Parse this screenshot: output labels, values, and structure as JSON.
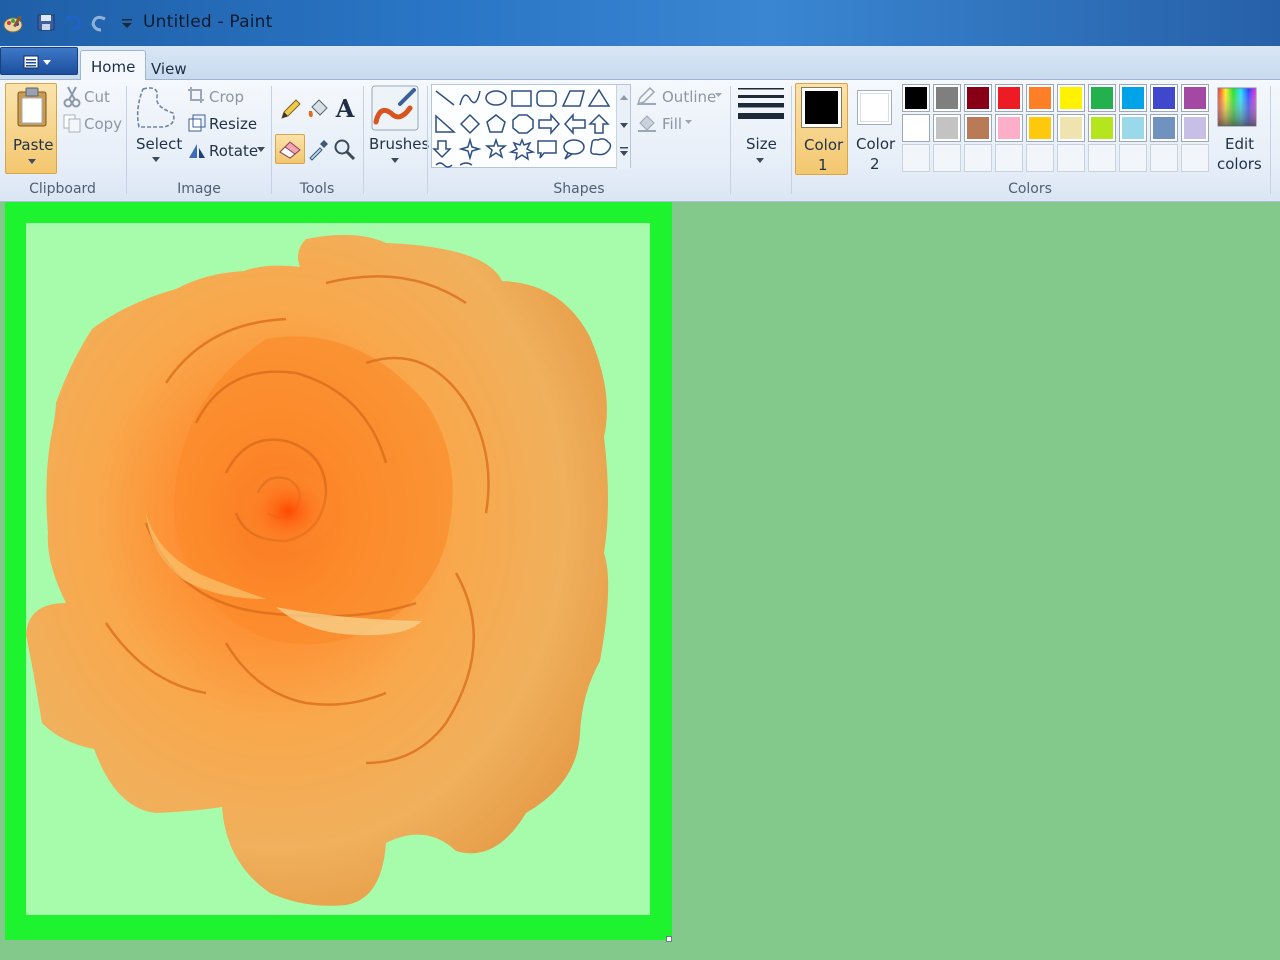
{
  "window": {
    "title": "Untitled - Paint"
  },
  "tabs": [
    {
      "label": "Home"
    },
    {
      "label": "View"
    }
  ],
  "ribbon": {
    "clipboard": {
      "paste_label": "Paste",
      "cut_label": "Cut",
      "copy_label": "Copy",
      "group_label": "Clipboard"
    },
    "image": {
      "select_label": "Select",
      "crop_label": "Crop",
      "resize_label": "Resize",
      "rotate_label": "Rotate",
      "group_label": "Image"
    },
    "tools": {
      "group_label": "Tools",
      "text_tool_glyph": "A"
    },
    "brushes": {
      "label": "Brushes"
    },
    "shapes": {
      "outline_label": "Outline",
      "fill_label": "Fill",
      "group_label": "Shapes"
    },
    "size": {
      "label": "Size"
    },
    "colors": {
      "color1_label": "Color",
      "color1_number": "1",
      "color2_label": "Color",
      "color2_number": "2",
      "edit_label_line1": "Edit",
      "edit_label_line2": "colors",
      "group_label": "Colors",
      "color1_value": "#000000",
      "color2_value": "#ffffff",
      "palette_row1": [
        "#000000",
        "#7f7f7f",
        "#880015",
        "#ed1c24",
        "#ff7f27",
        "#fff200",
        "#22b14c",
        "#00a2e8",
        "#3f48cc",
        "#a349a4"
      ],
      "palette_row2": [
        "#ffffff",
        "#c3c3c3",
        "#b97a57",
        "#ffaec9",
        "#ffc90e",
        "#efe4b0",
        "#b5e61d",
        "#99d9ea",
        "#7092be",
        "#c8bfe7"
      ]
    }
  },
  "canvas": {
    "frame_color": "#1ef330",
    "fill_color": "#a6fcaa",
    "workspace_color": "#84c98c",
    "content": "orange-rose-image"
  }
}
